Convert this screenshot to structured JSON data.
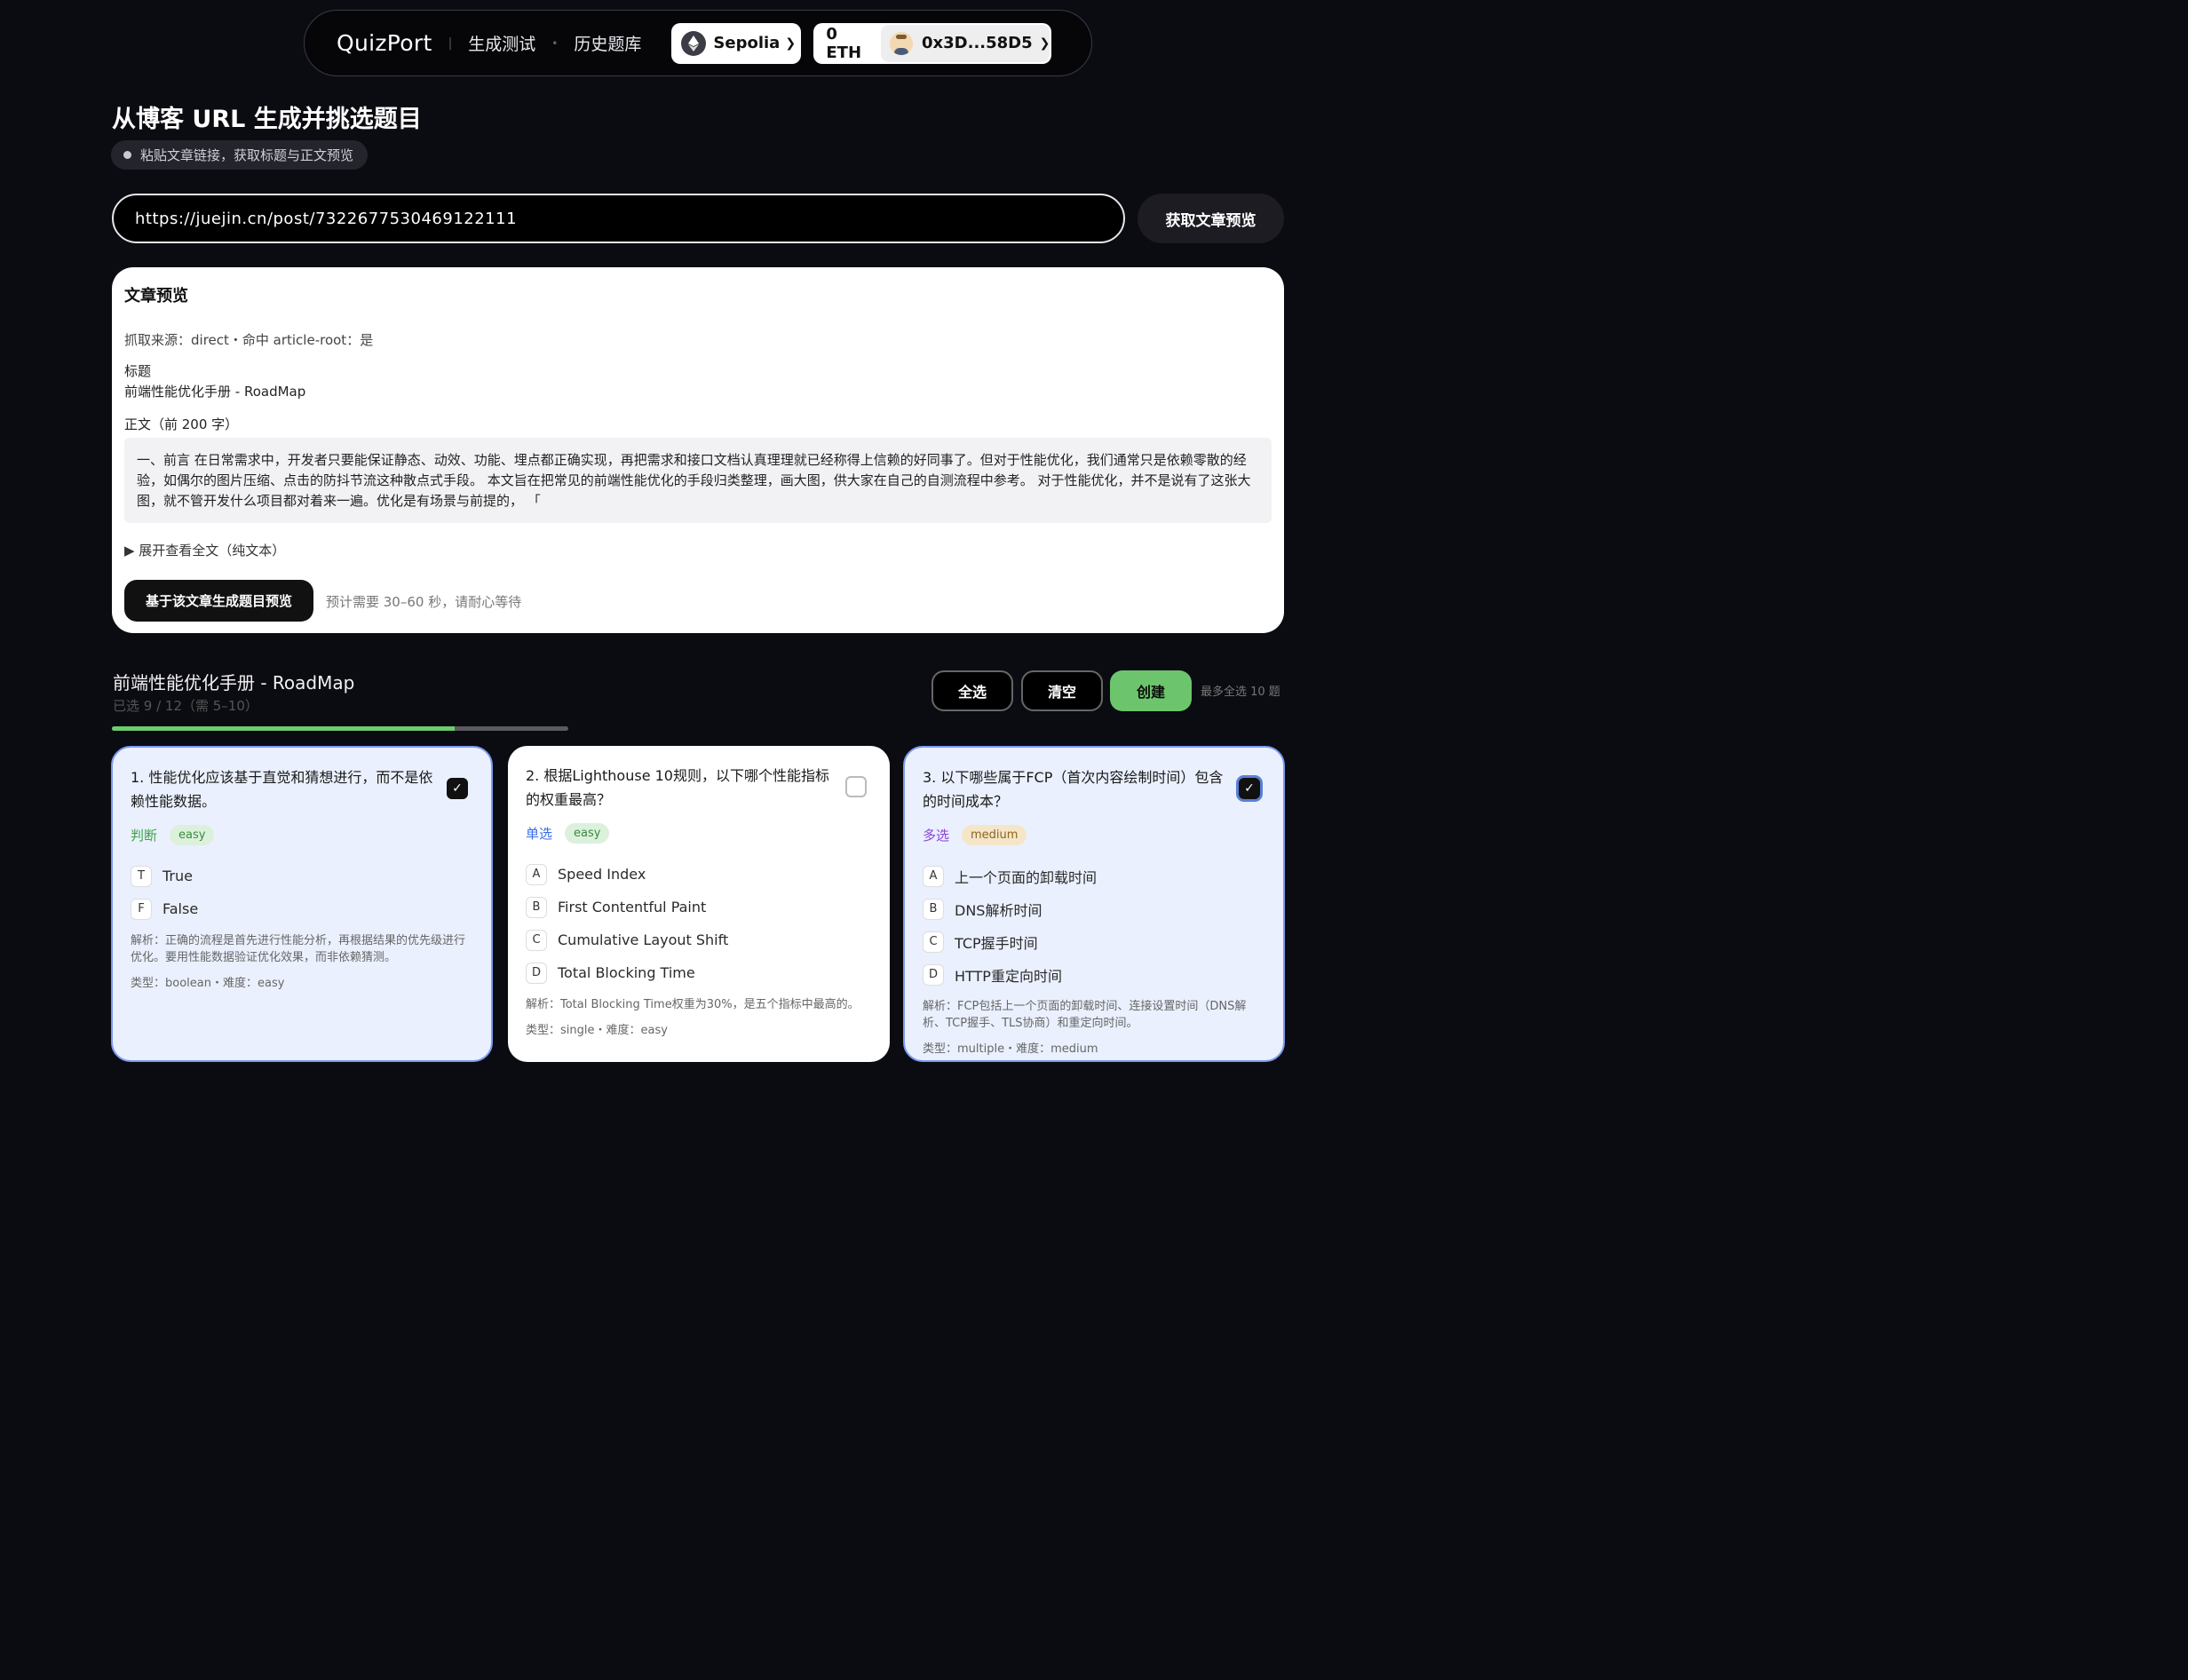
{
  "nav": {
    "brand": "QuizPort",
    "links": [
      "生成测试",
      "历史题库"
    ],
    "network": "Sepolia",
    "balance": "0 ETH",
    "address": "0x3D...58D5"
  },
  "header": {
    "title": "从博客 URL 生成并挑选题目",
    "hint": "粘贴文章链接，获取标题与正文预览"
  },
  "url_input": {
    "value": "https://juejin.cn/post/7322677530469122111"
  },
  "fetch_button": "获取文章预览",
  "preview": {
    "heading": "文章预览",
    "source": "抓取来源：direct・命中 article-root：是",
    "title_label": "标题",
    "title_value": "前端性能优化手册 - RoadMap",
    "body_label": "正文（前 200 字）",
    "body_text": "一、前言  在日常需求中，开发者只要能保证静态、动效、功能、埋点都正确实现，再把需求和接口文档认真理理就已经称得上信赖的好同事了。但对于性能优化，我们通常只是依赖零散的经验，如偶尔的图片压缩、点击的防抖节流这种散点式手段。  本文旨在把常见的前端性能优化的手段归类整理，画大图，供大家在自己的自测流程中参考。  对于性能优化，并不是说有了这张大图，就不管开发什么项目都对着来一遍。优化是有场景与前提的，   「",
    "expand": "▶ 展开查看全文（纯文本）",
    "gen_button": "基于该文章生成题目预览",
    "gen_hint": "预计需要 30–60 秒，请耐心等待"
  },
  "questions_header": {
    "title": "前端性能优化手册 - RoadMap",
    "count": "已选 9 / 12（需 5–10）",
    "progress": 0.75,
    "select_all": "全选",
    "clear": "清空",
    "create": "创建",
    "max_hint": "最多全选 10 题"
  },
  "cards": [
    {
      "question": "1. 性能优化应该基于直觉和猜想进行，而不是依赖性能数据。",
      "type_label": "判断",
      "difficulty": "easy",
      "selected": true,
      "options": [
        [
          "T",
          "True"
        ],
        [
          "F",
          "False"
        ]
      ],
      "explanation": "解析：正确的流程是首先进行性能分析，再根据结果的优先级进行优化。要用性能数据验证优化效果，而非依赖猜测。",
      "meta": "类型：boolean・难度：easy"
    },
    {
      "question": "2. 根据Lighthouse 10规则，以下哪个性能指标的权重最高？",
      "type_label": "单选",
      "difficulty": "easy",
      "selected": false,
      "options": [
        [
          "A",
          "Speed Index"
        ],
        [
          "B",
          "First Contentful Paint"
        ],
        [
          "C",
          "Cumulative Layout Shift"
        ],
        [
          "D",
          "Total Blocking Time"
        ]
      ],
      "explanation": "解析：Total Blocking Time权重为30%，是五个指标中最高的。",
      "meta": "类型：single・难度：easy"
    },
    {
      "question": "3. 以下哪些属于FCP（首次内容绘制时间）包含的时间成本？",
      "type_label": "多选",
      "difficulty": "medium",
      "selected": true,
      "options": [
        [
          "A",
          "上一个页面的卸载时间"
        ],
        [
          "B",
          "DNS解析时间"
        ],
        [
          "C",
          "TCP握手时间"
        ],
        [
          "D",
          "HTTP重定向时间"
        ]
      ],
      "explanation": "解析：FCP包括上一个页面的卸载时间、连接设置时间（DNS解析、TCP握手、TLS协商）和重定向时间。",
      "meta": "类型：multiple・难度：medium"
    }
  ],
  "colors": {
    "accent_green": "#6cc56d",
    "bool_green": "#3fa24a",
    "single_blue": "#3b6ee8",
    "multi_purple": "#8a44d6",
    "easy_bg": "#dcf1dc",
    "medium_bg": "#f5e6c8"
  }
}
